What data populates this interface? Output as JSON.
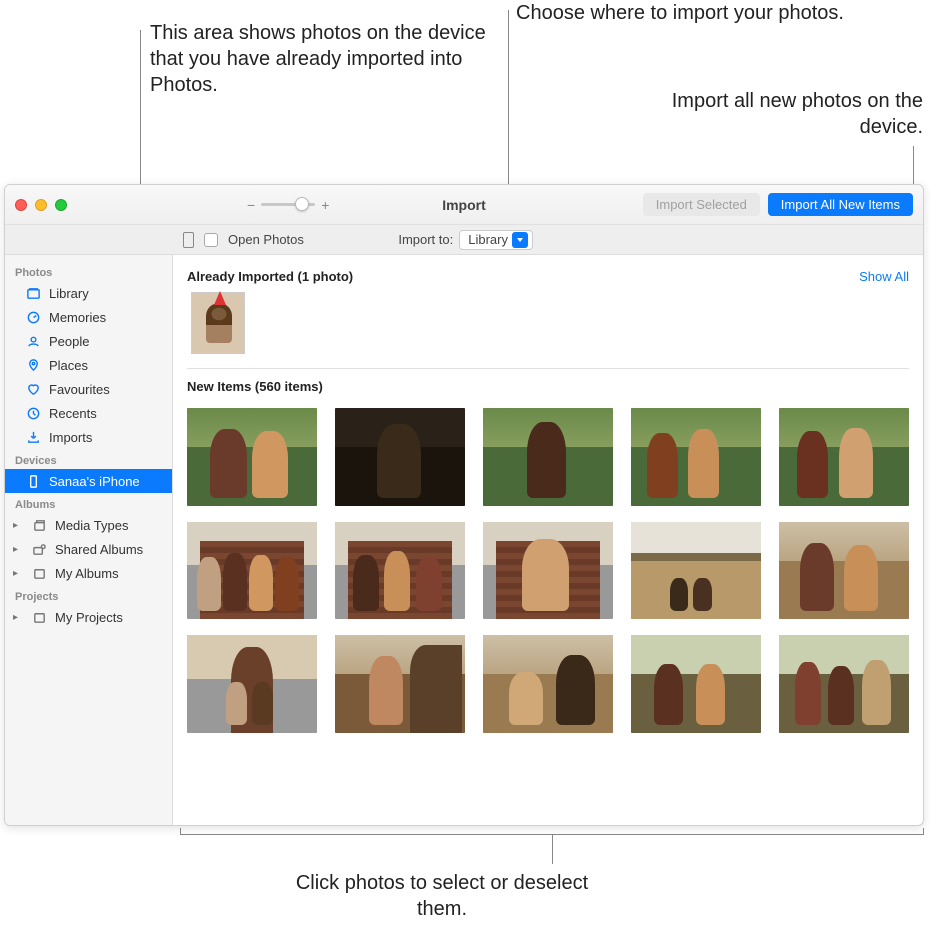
{
  "callouts": {
    "already": "This area shows photos on the device that you have already imported into Photos.",
    "import_to": "Choose where to import your photos.",
    "import_all": "Import all new photos on the device.",
    "select": "Click photos to select or deselect them."
  },
  "toolbar": {
    "title": "Import",
    "import_selected": "Import Selected",
    "import_all": "Import All New Items"
  },
  "secondary": {
    "open_photos": "Open Photos",
    "import_to_label": "Import to:",
    "import_to_value": "Library"
  },
  "sidebar": {
    "sections": {
      "photos": "Photos",
      "devices": "Devices",
      "albums": "Albums",
      "projects": "Projects"
    },
    "photos": [
      {
        "label": "Library",
        "icon": "library"
      },
      {
        "label": "Memories",
        "icon": "memories"
      },
      {
        "label": "People",
        "icon": "people"
      },
      {
        "label": "Places",
        "icon": "places"
      },
      {
        "label": "Favourites",
        "icon": "favourites"
      },
      {
        "label": "Recents",
        "icon": "recents"
      },
      {
        "label": "Imports",
        "icon": "imports"
      }
    ],
    "devices": [
      {
        "label": "Sanaa's iPhone",
        "icon": "phone",
        "selected": true
      }
    ],
    "albums": [
      {
        "label": "Media Types",
        "icon": "stack",
        "disclosure": true
      },
      {
        "label": "Shared Albums",
        "icon": "shared",
        "disclosure": true
      },
      {
        "label": "My Albums",
        "icon": "album",
        "disclosure": true
      }
    ],
    "projects": [
      {
        "label": "My Projects",
        "icon": "album",
        "disclosure": true
      }
    ]
  },
  "content": {
    "already_header": "Already Imported (1 photo)",
    "show_all": "Show All",
    "new_header": "New Items (560 items)"
  }
}
